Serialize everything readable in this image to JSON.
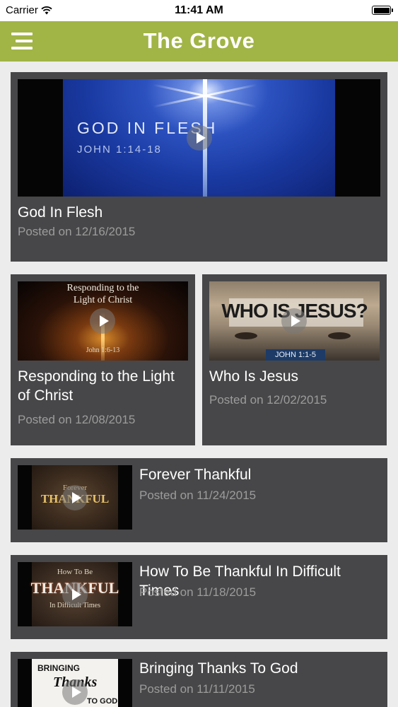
{
  "status_bar": {
    "carrier": "Carrier",
    "time": "11:41 AM"
  },
  "header": {
    "title": "The Grove"
  },
  "sermons": [
    {
      "title": "God In Flesh",
      "date": "Posted on 12/16/2015",
      "thumb_text": [
        "GOD IN FLESH",
        "JOHN 1:14-18"
      ]
    },
    {
      "title": "Responding to the Light of Christ",
      "date": "Posted on 12/08/2015",
      "thumb_text": [
        "Responding to the",
        "Light of Christ",
        "John 1:6-13"
      ]
    },
    {
      "title": "Who Is Jesus",
      "date": "Posted on 12/02/2015",
      "thumb_text": [
        "WHO IS JESUS?",
        "JOHN 1:1-5"
      ]
    },
    {
      "title": "Forever Thankful",
      "date": "Posted on 11/24/2015",
      "thumb_text": [
        "Forever",
        "THANKFUL"
      ]
    },
    {
      "title": "How To Be Thankful In Difficult Times",
      "date": "Posted on 11/18/2015",
      "thumb_text": [
        "How To Be",
        "THANKFUL",
        "In Difficult Times"
      ]
    },
    {
      "title": "Bringing Thanks To God",
      "date": "Posted on 11/11/2015",
      "thumb_text": [
        "BRINGING",
        "Thanks",
        "TO GOD"
      ]
    }
  ],
  "colors": {
    "header_bg": "#a1b446",
    "card_bg": "#474749",
    "page_bg": "#ececec",
    "date_text": "#9c9c9c"
  },
  "icons": [
    "wifi-icon",
    "battery-icon",
    "menu-icon",
    "play-icon"
  ]
}
